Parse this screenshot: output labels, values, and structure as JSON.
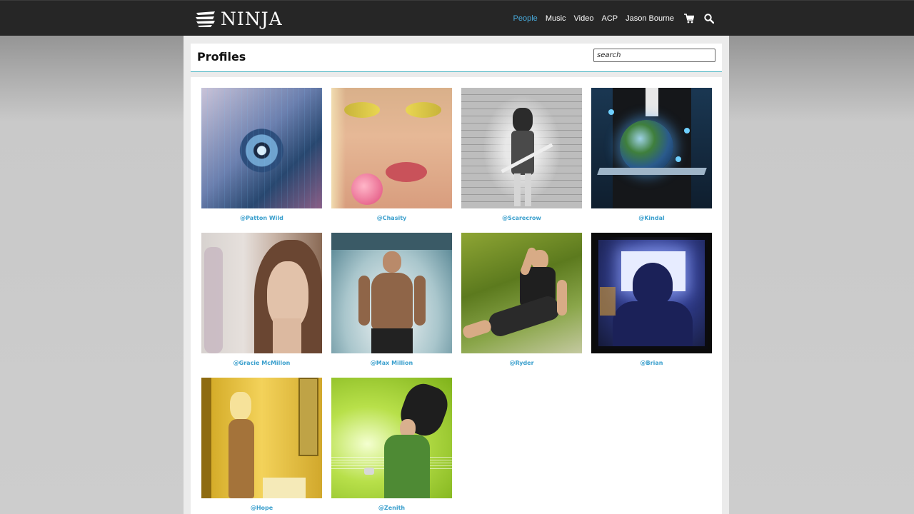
{
  "brand": {
    "name": "NINJA"
  },
  "nav": {
    "items": [
      {
        "label": "People",
        "active": true
      },
      {
        "label": "Music",
        "active": false
      },
      {
        "label": "Video",
        "active": false
      },
      {
        "label": "ACP",
        "active": false
      },
      {
        "label": "Jason Bourne",
        "active": false
      }
    ],
    "icons": [
      "cart-icon",
      "search-icon"
    ]
  },
  "page": {
    "title": "Profiles",
    "search_placeholder": "search"
  },
  "profiles": [
    {
      "name": "@Patton Wild",
      "photo_theme": "blue-eye"
    },
    {
      "name": "@Chasity",
      "photo_theme": "makeup-lollipop"
    },
    {
      "name": "@Scarecrow",
      "photo_theme": "grayscale-bat"
    },
    {
      "name": "@Kindal",
      "photo_theme": "globe-tablet"
    },
    {
      "name": "@Gracie McMillon",
      "photo_theme": "portrait"
    },
    {
      "name": "@Max Million",
      "photo_theme": "angel-wings"
    },
    {
      "name": "@Ryder",
      "photo_theme": "kick"
    },
    {
      "name": "@Brian",
      "photo_theme": "computer-night"
    },
    {
      "name": "@Hope",
      "photo_theme": "yellow-mirror"
    },
    {
      "name": "@Zenith",
      "photo_theme": "green-music"
    }
  ],
  "colors": {
    "nav_active": "#47a9da",
    "profile_link": "#3a9fcd",
    "topbar": "#262626",
    "header_rule": "#4ab4c2"
  }
}
